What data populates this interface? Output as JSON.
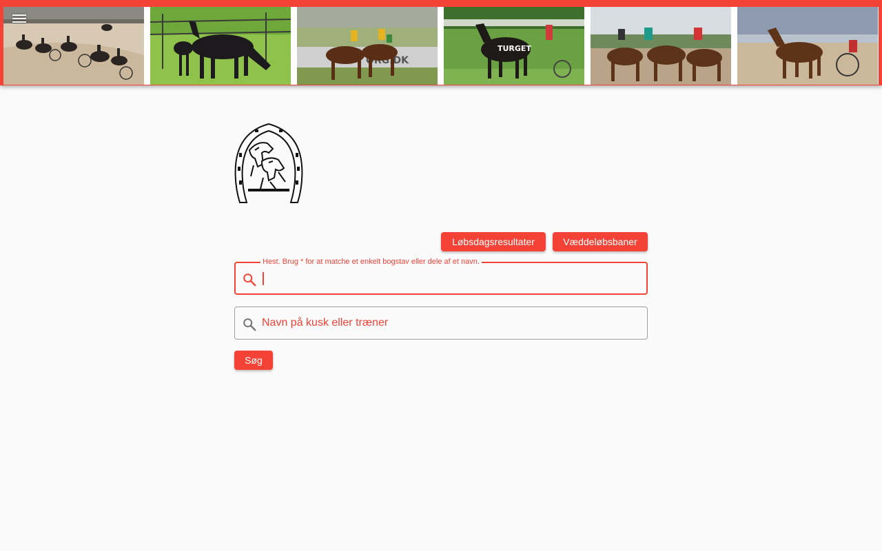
{
  "header": {
    "menu_icon": "hamburger-menu-icon",
    "accent_color": "#f44336",
    "photos": [
      "harness-race-pack-icon",
      "mare-and-foal-icon",
      "gallop-race-icon",
      "trotter-winner-blanket-icon",
      "gallop-finish-icon",
      "trotter-sulky-icon"
    ]
  },
  "logo": {
    "icon": "horseshoe-horses-logo-icon"
  },
  "actions": {
    "race_day_results": "Løbsdagsresultater",
    "race_tracks": "Væddeløbsbaner"
  },
  "horse_search": {
    "label": "Hest. Brug * for at matche et enkelt bogstav eller dele af et navn.",
    "value": "",
    "icon": "search-icon"
  },
  "person_search": {
    "placeholder": "Navn på kusk eller træner",
    "value": "",
    "icon": "search-icon"
  },
  "search_button": "Søg"
}
